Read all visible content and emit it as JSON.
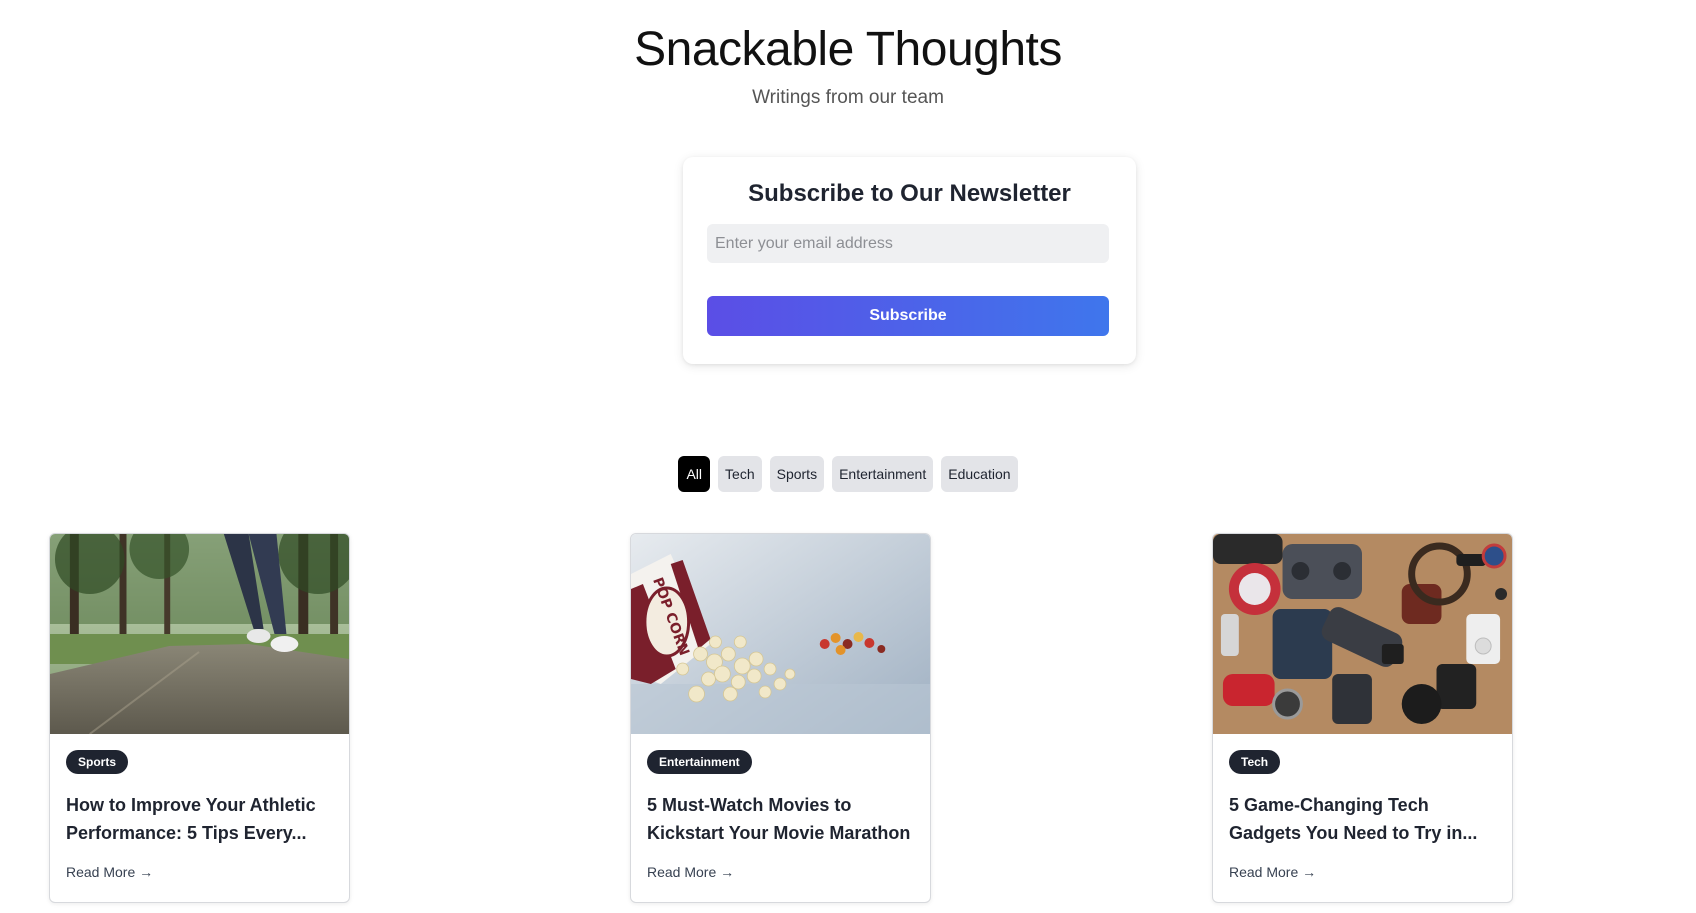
{
  "header": {
    "title": "Snackable Thoughts",
    "subtitle": "Writings from our team"
  },
  "newsletter": {
    "heading": "Subscribe to Our Newsletter",
    "email_placeholder": "Enter your email address",
    "email_value": "",
    "button_label": "Subscribe",
    "button_gradient": [
      "#5b4ee6",
      "#3f76ec"
    ]
  },
  "filters": [
    {
      "label": "All",
      "active": true
    },
    {
      "label": "Tech",
      "active": false
    },
    {
      "label": "Sports",
      "active": false
    },
    {
      "label": "Entertainment",
      "active": false
    },
    {
      "label": "Education",
      "active": false
    }
  ],
  "posts": [
    {
      "category": "Sports",
      "title": "How to Improve Your Athletic Performance: 5 Tips Every...",
      "read_more": "Read More →",
      "image": "runner-on-park-path"
    },
    {
      "category": "Entertainment",
      "title": "5 Must-Watch Movies to Kickstart Your Movie Marathon",
      "read_more": "Read More →",
      "image": "popcorn-spilling-from-box",
      "image_text": "POP CORN"
    },
    {
      "category": "Tech",
      "title": "5 Game-Changing Tech Gadgets You Need to Try in...",
      "read_more": "Read More →",
      "image": "tech-gadgets-flat-lay"
    }
  ],
  "colors": {
    "badge_bg": "#1f2430",
    "active_filter_bg": "#000000",
    "filter_bg": "#e3e4e8",
    "input_bg": "#eff0f2"
  }
}
